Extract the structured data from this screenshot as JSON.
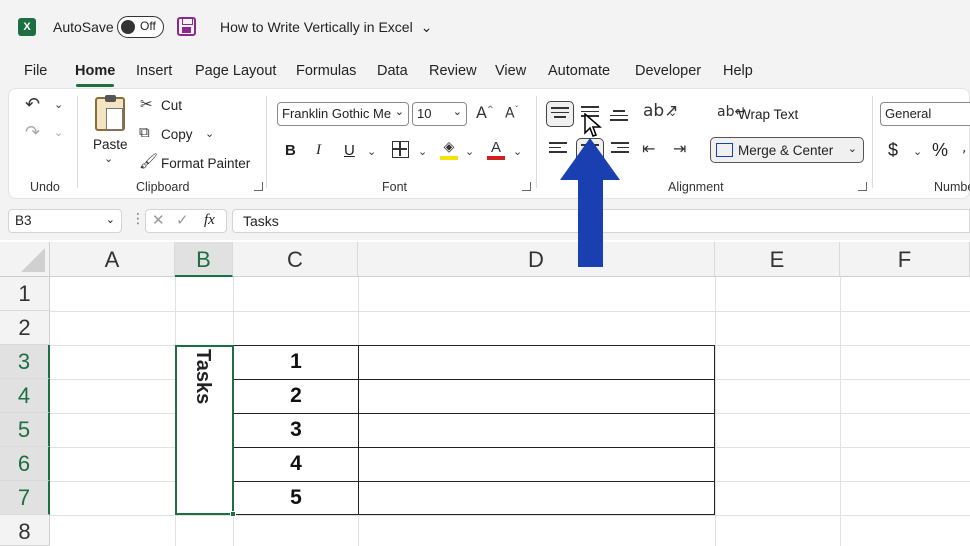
{
  "titlebar": {
    "logo": "X",
    "autosave_label": "AutoSave",
    "autosave_state": "Off",
    "doc_title": "How to Write Vertically in Excel",
    "title_dropdown": "⌄"
  },
  "tabs": [
    {
      "label": "File"
    },
    {
      "label": "Home"
    },
    {
      "label": "Insert"
    },
    {
      "label": "Page Layout"
    },
    {
      "label": "Formulas"
    },
    {
      "label": "Data"
    },
    {
      "label": "Review"
    },
    {
      "label": "View"
    },
    {
      "label": "Automate"
    },
    {
      "label": "Developer"
    },
    {
      "label": "Help"
    }
  ],
  "ribbon": {
    "undo_group": "Undo",
    "clipboard": {
      "group": "Clipboard",
      "paste": "Paste",
      "cut": "Cut",
      "copy": "Copy",
      "format_painter": "Format Painter"
    },
    "font": {
      "group": "Font",
      "font_name": "Franklin Gothic Me",
      "font_size": "10",
      "bold": "B",
      "italic": "I",
      "underline": "U"
    },
    "alignment": {
      "group": "Alignment",
      "wrap_text": "Wrap Text",
      "merge_center": "Merge & Center"
    },
    "number": {
      "group": "Numbe",
      "format": "General",
      "currency": "$",
      "percent": "%"
    }
  },
  "formula_bar": {
    "name_box": "B3",
    "fx": "fx",
    "content": "Tasks"
  },
  "grid": {
    "columns": [
      "A",
      "B",
      "C",
      "D",
      "E",
      "F"
    ],
    "rows": [
      "1",
      "2",
      "3",
      "4",
      "5",
      "6",
      "7",
      "8"
    ],
    "merged_cell_text": "Tasks",
    "values": [
      "1",
      "2",
      "3",
      "4",
      "5"
    ]
  },
  "colors": {
    "accent": "#1d6f42",
    "arrow": "#1a3fb0"
  }
}
